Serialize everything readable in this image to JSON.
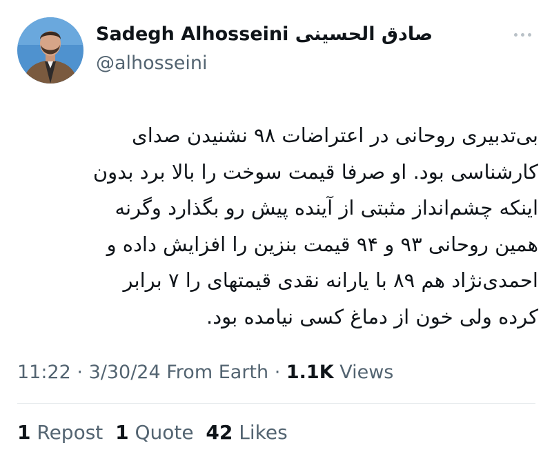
{
  "author": {
    "display_name": "Sadegh Alhosseini صادق الحسینی",
    "handle": "@alhosseini"
  },
  "tweet": {
    "text": "بی‌تدبیری روحانی در اعتراضات ۹۸ نشنیدن صدای\nکارشناسی بود. او صرفا قیمت سوخت را بالا برد بدون\nاینکه چشم‌انداز مثبتی از آینده پیش رو بگذارد وگرنه\nهمین روحانی ۹۳ و ۹۴ قیمت بنزین را افزایش داده و\nاحمدی‌نژاد هم ۸۹ با یارانه نقدی قیمتهای را ۷ برابر\nکرده ولی خون از دماغ کسی نیامده بود."
  },
  "meta": {
    "time": "11:22",
    "sep1": " · ",
    "date": "3/30/24",
    "source": " From Earth",
    "sep2": " · ",
    "views_count": "1.1K",
    "views_label": " Views"
  },
  "stats": {
    "reposts": {
      "count": "1",
      "label": " Repost"
    },
    "quotes": {
      "count": "1",
      "label": " Quote"
    },
    "likes": {
      "count": "42",
      "label": " Likes"
    }
  },
  "icons": {
    "more": "more-horizontal-icon"
  },
  "colors": {
    "text_primary": "#0f1419",
    "text_secondary": "#536471",
    "divider": "#e6eaed"
  }
}
